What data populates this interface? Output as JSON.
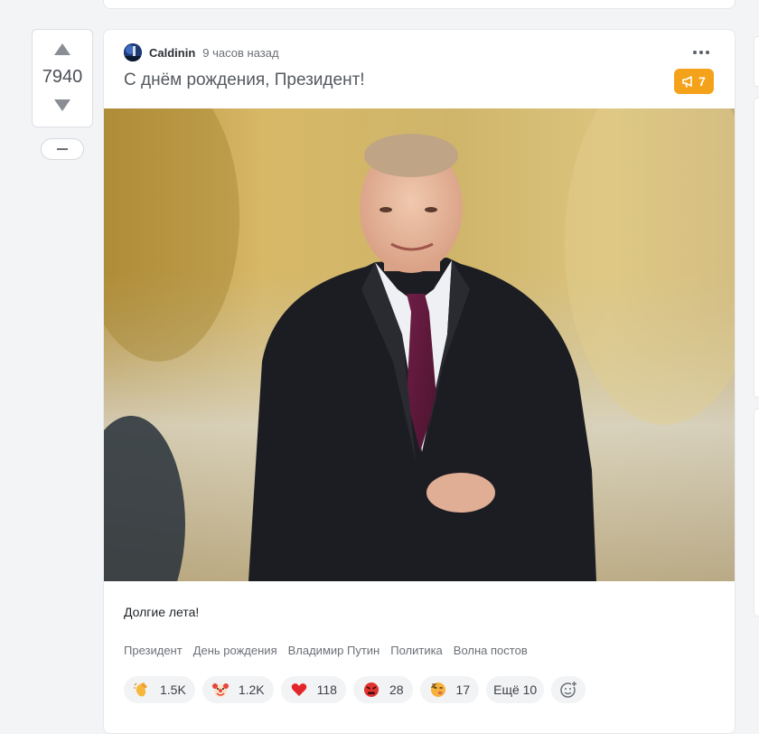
{
  "vote": {
    "count": "7940"
  },
  "post": {
    "author": "Caldinin",
    "time": "9 часов назад",
    "title": "С днём рождения, Президент!",
    "comments_count": "7",
    "text": "Долгие лета!",
    "tags": [
      "Президент",
      "День рождения",
      "Владимир Путин",
      "Политика",
      "Волна постов"
    ],
    "reactions": [
      {
        "icon": "clapping-hands-icon",
        "count": "1.5K"
      },
      {
        "icon": "clown-face-icon",
        "count": "1.2K"
      },
      {
        "icon": "heart-icon",
        "count": "118"
      },
      {
        "icon": "angry-face-icon",
        "count": "28"
      },
      {
        "icon": "sleepy-face-icon",
        "count": "17"
      }
    ],
    "more_reactions_label": "Ещё 10"
  },
  "colors": {
    "accent": "#f5a21b",
    "background": "#f3f4f6",
    "card": "#ffffff"
  }
}
